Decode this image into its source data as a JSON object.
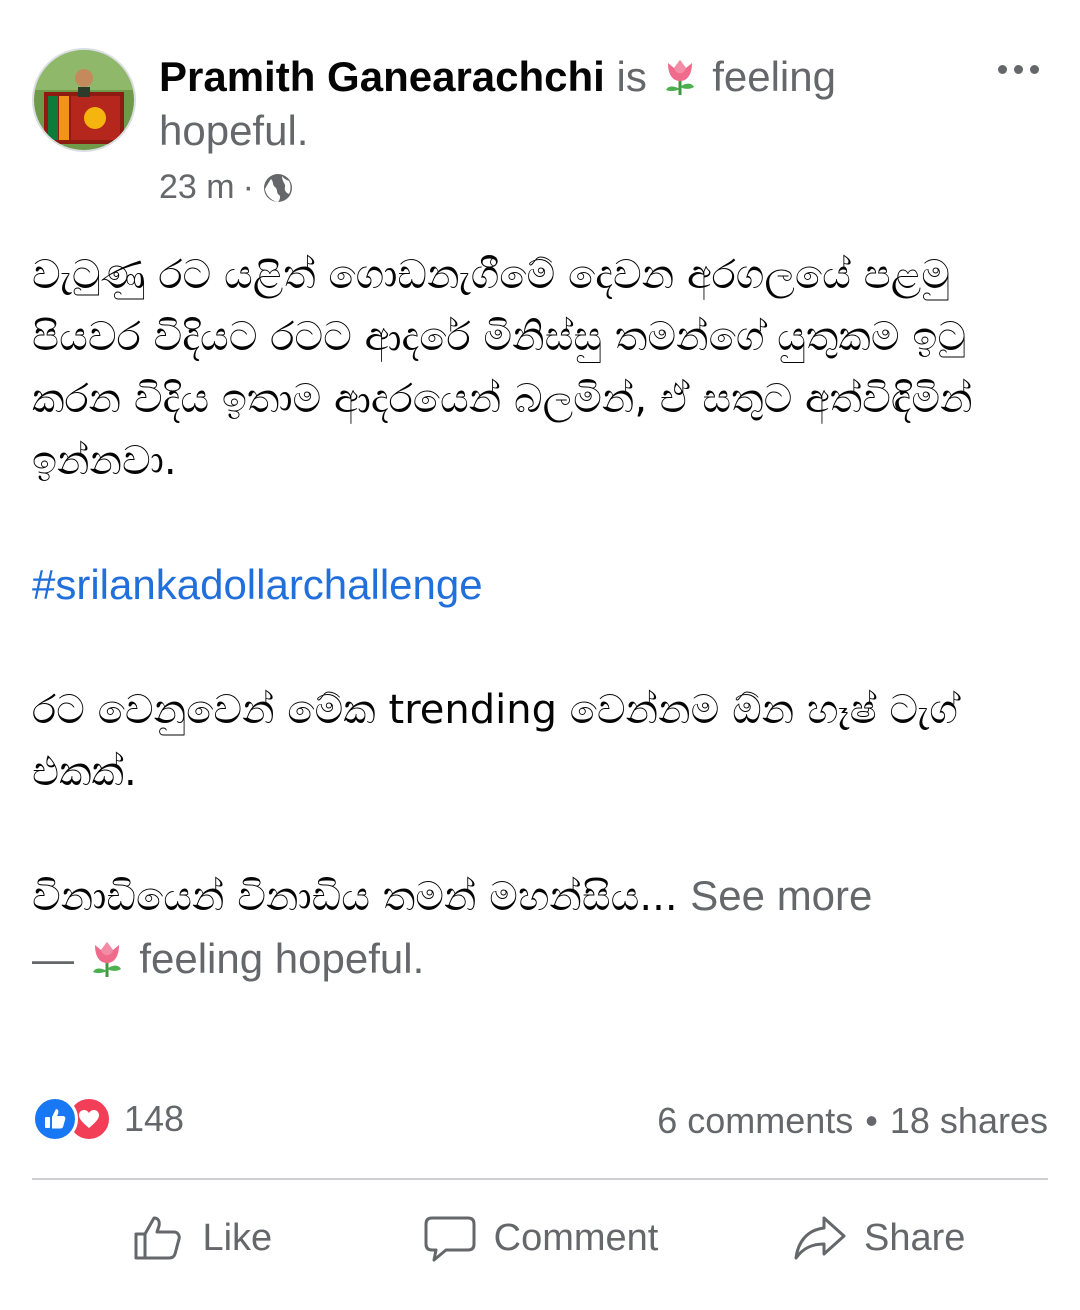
{
  "post": {
    "author": "Pramith Ganearachchi",
    "activity_verb": "is",
    "feeling_word": "feeling",
    "feeling_value": "hopeful.",
    "feeling_emoji": "tulip",
    "time": "23 m",
    "time_separator": "·",
    "privacy_icon": "globe-icon",
    "more_icon": "more-options-icon"
  },
  "content": {
    "paragraph_1": "වැටුණු රට යළිත් ගොඩනැගීමේ දෙවන අරගලයේ පළමු පියවර විදියට රටට ආදරේ මිනිස්සු තමන්ගේ යුතුකම ඉටු කරන විදිය ඉතාම ආදරයෙන් බලමින්, ඒ සතුට අත්විඳිමින් ඉන්නවා.",
    "hashtag": "#srilankadollarchallenge",
    "paragraph_3": "රට වෙනුවෙන් මේක trending වෙන්නම ඕන හෑෂ් ටැග් එකක්.",
    "paragraph_4_truncated": "විනාඩියෙන් විනාඩිය තමන් මහන්සිය...",
    "see_more": "See more",
    "feeling_dash": "—",
    "feeling_footer": "feeling hopeful."
  },
  "stats": {
    "reaction_count": "148",
    "comments": "6 comments",
    "separator": "•",
    "shares": "18 shares"
  },
  "actions": {
    "like": "Like",
    "comment": "Comment",
    "share": "Share"
  },
  "colors": {
    "hashtag": "#216fdb",
    "secondary_text": "#65676b",
    "like_blue": "#1877f2",
    "love_red": "#f33e58"
  }
}
